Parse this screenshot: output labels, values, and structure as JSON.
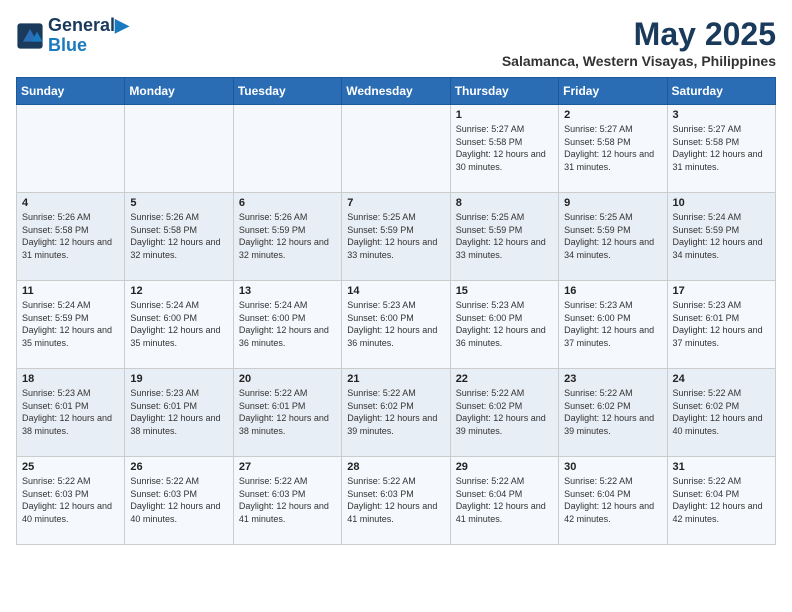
{
  "logo": {
    "line1": "General",
    "line2": "Blue"
  },
  "title": "May 2025",
  "location": "Salamanca, Western Visayas, Philippines",
  "weekdays": [
    "Sunday",
    "Monday",
    "Tuesday",
    "Wednesday",
    "Thursday",
    "Friday",
    "Saturday"
  ],
  "weeks": [
    [
      {
        "day": "",
        "sunrise": "",
        "sunset": "",
        "daylight": ""
      },
      {
        "day": "",
        "sunrise": "",
        "sunset": "",
        "daylight": ""
      },
      {
        "day": "",
        "sunrise": "",
        "sunset": "",
        "daylight": ""
      },
      {
        "day": "",
        "sunrise": "",
        "sunset": "",
        "daylight": ""
      },
      {
        "day": "1",
        "sunrise": "5:27 AM",
        "sunset": "5:58 PM",
        "daylight": "12 hours and 30 minutes."
      },
      {
        "day": "2",
        "sunrise": "5:27 AM",
        "sunset": "5:58 PM",
        "daylight": "12 hours and 31 minutes."
      },
      {
        "day": "3",
        "sunrise": "5:27 AM",
        "sunset": "5:58 PM",
        "daylight": "12 hours and 31 minutes."
      }
    ],
    [
      {
        "day": "4",
        "sunrise": "5:26 AM",
        "sunset": "5:58 PM",
        "daylight": "12 hours and 31 minutes."
      },
      {
        "day": "5",
        "sunrise": "5:26 AM",
        "sunset": "5:58 PM",
        "daylight": "12 hours and 32 minutes."
      },
      {
        "day": "6",
        "sunrise": "5:26 AM",
        "sunset": "5:59 PM",
        "daylight": "12 hours and 32 minutes."
      },
      {
        "day": "7",
        "sunrise": "5:25 AM",
        "sunset": "5:59 PM",
        "daylight": "12 hours and 33 minutes."
      },
      {
        "day": "8",
        "sunrise": "5:25 AM",
        "sunset": "5:59 PM",
        "daylight": "12 hours and 33 minutes."
      },
      {
        "day": "9",
        "sunrise": "5:25 AM",
        "sunset": "5:59 PM",
        "daylight": "12 hours and 34 minutes."
      },
      {
        "day": "10",
        "sunrise": "5:24 AM",
        "sunset": "5:59 PM",
        "daylight": "12 hours and 34 minutes."
      }
    ],
    [
      {
        "day": "11",
        "sunrise": "5:24 AM",
        "sunset": "5:59 PM",
        "daylight": "12 hours and 35 minutes."
      },
      {
        "day": "12",
        "sunrise": "5:24 AM",
        "sunset": "6:00 PM",
        "daylight": "12 hours and 35 minutes."
      },
      {
        "day": "13",
        "sunrise": "5:24 AM",
        "sunset": "6:00 PM",
        "daylight": "12 hours and 36 minutes."
      },
      {
        "day": "14",
        "sunrise": "5:23 AM",
        "sunset": "6:00 PM",
        "daylight": "12 hours and 36 minutes."
      },
      {
        "day": "15",
        "sunrise": "5:23 AM",
        "sunset": "6:00 PM",
        "daylight": "12 hours and 36 minutes."
      },
      {
        "day": "16",
        "sunrise": "5:23 AM",
        "sunset": "6:00 PM",
        "daylight": "12 hours and 37 minutes."
      },
      {
        "day": "17",
        "sunrise": "5:23 AM",
        "sunset": "6:01 PM",
        "daylight": "12 hours and 37 minutes."
      }
    ],
    [
      {
        "day": "18",
        "sunrise": "5:23 AM",
        "sunset": "6:01 PM",
        "daylight": "12 hours and 38 minutes."
      },
      {
        "day": "19",
        "sunrise": "5:23 AM",
        "sunset": "6:01 PM",
        "daylight": "12 hours and 38 minutes."
      },
      {
        "day": "20",
        "sunrise": "5:22 AM",
        "sunset": "6:01 PM",
        "daylight": "12 hours and 38 minutes."
      },
      {
        "day": "21",
        "sunrise": "5:22 AM",
        "sunset": "6:02 PM",
        "daylight": "12 hours and 39 minutes."
      },
      {
        "day": "22",
        "sunrise": "5:22 AM",
        "sunset": "6:02 PM",
        "daylight": "12 hours and 39 minutes."
      },
      {
        "day": "23",
        "sunrise": "5:22 AM",
        "sunset": "6:02 PM",
        "daylight": "12 hours and 39 minutes."
      },
      {
        "day": "24",
        "sunrise": "5:22 AM",
        "sunset": "6:02 PM",
        "daylight": "12 hours and 40 minutes."
      }
    ],
    [
      {
        "day": "25",
        "sunrise": "5:22 AM",
        "sunset": "6:03 PM",
        "daylight": "12 hours and 40 minutes."
      },
      {
        "day": "26",
        "sunrise": "5:22 AM",
        "sunset": "6:03 PM",
        "daylight": "12 hours and 40 minutes."
      },
      {
        "day": "27",
        "sunrise": "5:22 AM",
        "sunset": "6:03 PM",
        "daylight": "12 hours and 41 minutes."
      },
      {
        "day": "28",
        "sunrise": "5:22 AM",
        "sunset": "6:03 PM",
        "daylight": "12 hours and 41 minutes."
      },
      {
        "day": "29",
        "sunrise": "5:22 AM",
        "sunset": "6:04 PM",
        "daylight": "12 hours and 41 minutes."
      },
      {
        "day": "30",
        "sunrise": "5:22 AM",
        "sunset": "6:04 PM",
        "daylight": "12 hours and 42 minutes."
      },
      {
        "day": "31",
        "sunrise": "5:22 AM",
        "sunset": "6:04 PM",
        "daylight": "12 hours and 42 minutes."
      }
    ]
  ],
  "labels": {
    "sunrise": "Sunrise:",
    "sunset": "Sunset:",
    "daylight": "Daylight:"
  }
}
